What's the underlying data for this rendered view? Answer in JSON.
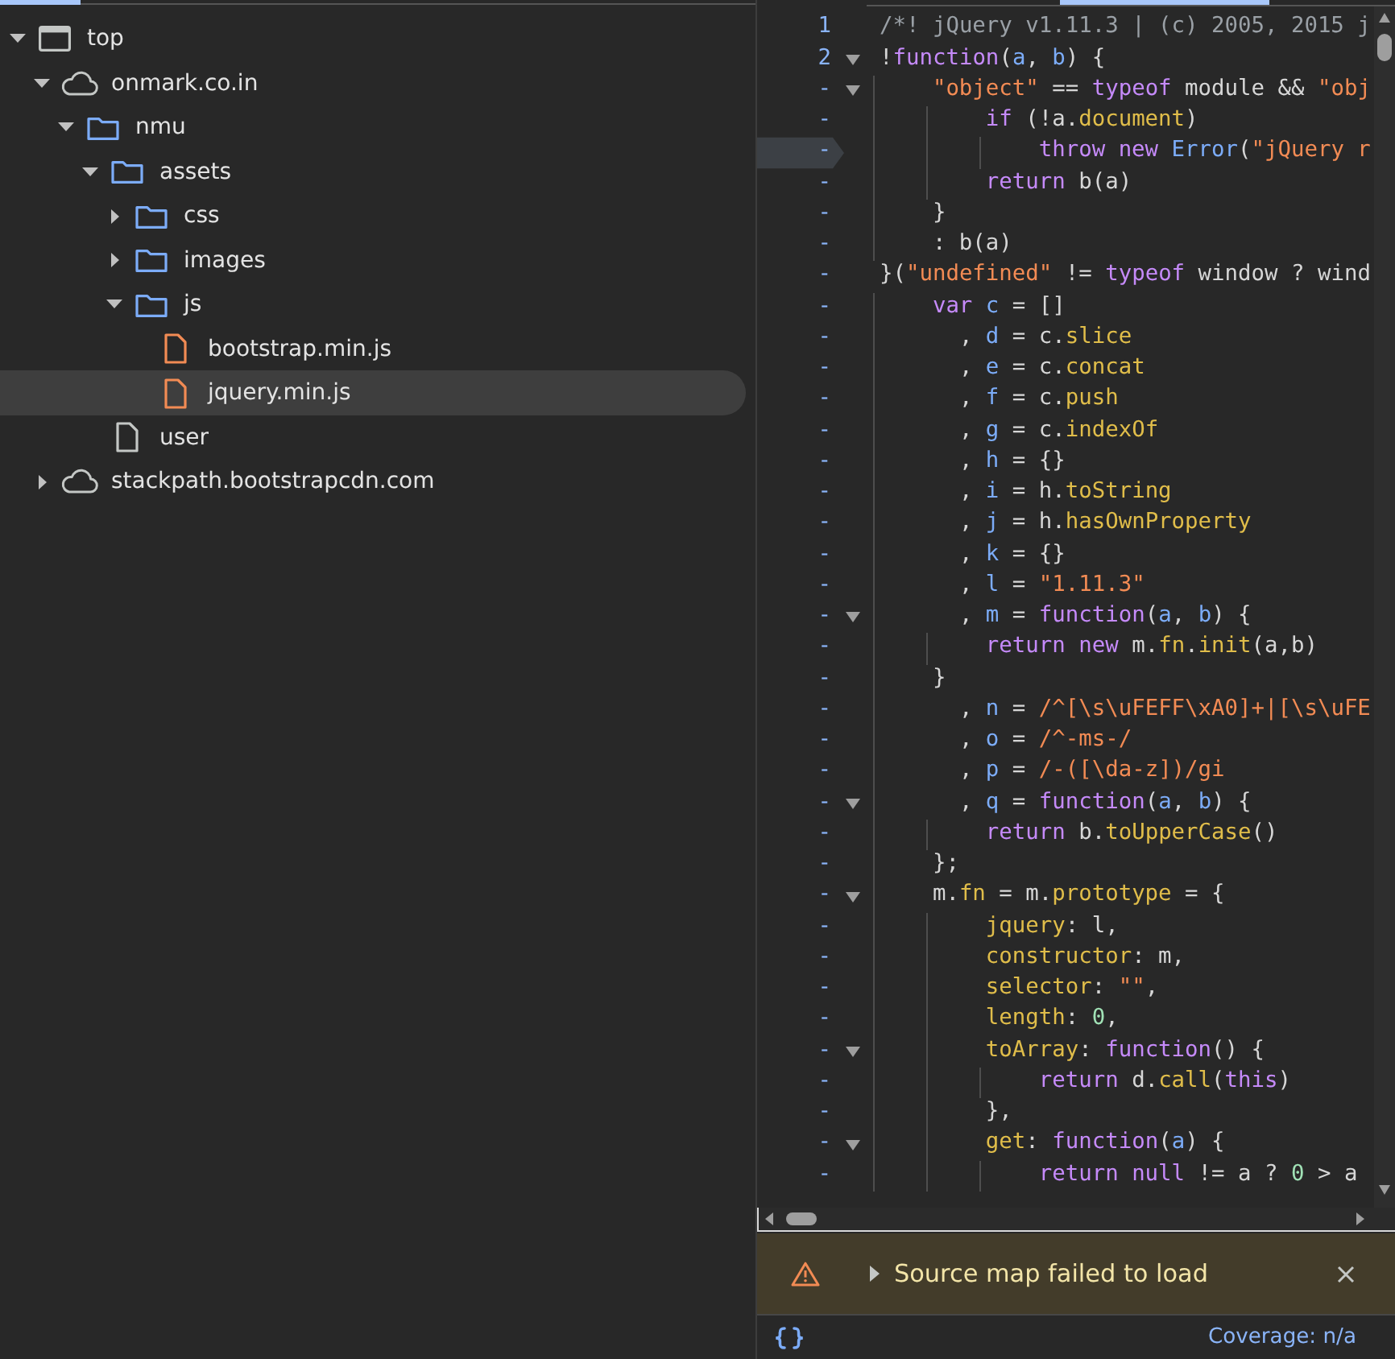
{
  "file_tree": [
    {
      "label": "top",
      "kind": "frame",
      "expanded": true,
      "selected": false,
      "children": [
        {
          "label": "onmark.co.in",
          "kind": "domain",
          "expanded": true,
          "selected": false,
          "children": [
            {
              "label": "nmu",
              "kind": "folder",
              "expanded": true,
              "selected": false,
              "children": [
                {
                  "label": "assets",
                  "kind": "folder",
                  "expanded": true,
                  "selected": false,
                  "children": [
                    {
                      "label": "css",
                      "kind": "folder",
                      "expanded": false,
                      "selected": false
                    },
                    {
                      "label": "images",
                      "kind": "folder",
                      "expanded": false,
                      "selected": false
                    },
                    {
                      "label": "js",
                      "kind": "folder",
                      "expanded": true,
                      "selected": false,
                      "children": [
                        {
                          "label": "bootstrap.min.js",
                          "kind": "script",
                          "selected": false
                        },
                        {
                          "label": "jquery.min.js",
                          "kind": "script",
                          "selected": true
                        }
                      ]
                    }
                  ]
                },
                {
                  "label": "user",
                  "kind": "document",
                  "selected": false
                }
              ]
            }
          ]
        },
        {
          "label": "stackpath.bootstrapcdn.com",
          "kind": "domain",
          "expanded": false,
          "selected": false
        }
      ]
    }
  ],
  "editor": {
    "lines": [
      {
        "number": "1",
        "foldable": false,
        "marked": false,
        "tokens": [
          {
            "kind": "comment",
            "text": "/*! jQuery v1.11.3 | (c) 2005, 2015 j"
          }
        ]
      },
      {
        "number": "2",
        "foldable": true,
        "marked": false,
        "tokens": [
          {
            "kind": "plain",
            "text": "!"
          },
          {
            "kind": "keyword",
            "text": "function"
          },
          {
            "kind": "plain",
            "text": "("
          },
          {
            "kind": "definition",
            "text": "a"
          },
          {
            "kind": "plain",
            "text": ", "
          },
          {
            "kind": "definition",
            "text": "b"
          },
          {
            "kind": "plain",
            "text": ") {"
          }
        ]
      },
      {
        "number": "-",
        "foldable": true,
        "marked": false,
        "tokens": [
          {
            "kind": "string",
            "text": "    \"object\""
          },
          {
            "kind": "plain",
            "text": " == "
          },
          {
            "kind": "keyword",
            "text": "typeof"
          },
          {
            "kind": "plain",
            "text": " module && "
          },
          {
            "kind": "string",
            "text": "\"obj"
          }
        ]
      },
      {
        "number": "-",
        "foldable": false,
        "marked": false,
        "tokens": [
          {
            "kind": "keyword",
            "text": "        if"
          },
          {
            "kind": "plain",
            "text": " (!a."
          },
          {
            "kind": "property",
            "text": "document"
          },
          {
            "kind": "plain",
            "text": ")"
          }
        ]
      },
      {
        "number": "-",
        "foldable": false,
        "marked": true,
        "tokens": [
          {
            "kind": "keyword",
            "text": "            throw"
          },
          {
            "kind": "keyword",
            "text": " new"
          },
          {
            "kind": "type",
            "text": " Error"
          },
          {
            "kind": "plain",
            "text": "("
          },
          {
            "kind": "string",
            "text": "\"jQuery r"
          }
        ]
      },
      {
        "number": "-",
        "foldable": false,
        "marked": false,
        "tokens": [
          {
            "kind": "keyword",
            "text": "        return"
          },
          {
            "kind": "plain",
            "text": " b(a)"
          }
        ]
      },
      {
        "number": "-",
        "foldable": false,
        "marked": false,
        "tokens": [
          {
            "kind": "plain",
            "text": "    }"
          }
        ]
      },
      {
        "number": "-",
        "foldable": false,
        "marked": false,
        "tokens": [
          {
            "kind": "plain",
            "text": "    : b(a)"
          }
        ]
      },
      {
        "number": "-",
        "foldable": false,
        "marked": false,
        "tokens": [
          {
            "kind": "plain",
            "text": "}("
          },
          {
            "kind": "string",
            "text": "\"undefined\""
          },
          {
            "kind": "plain",
            "text": " != "
          },
          {
            "kind": "keyword",
            "text": "typeof"
          },
          {
            "kind": "plain",
            "text": " window ? wind"
          }
        ]
      },
      {
        "number": "-",
        "foldable": false,
        "marked": false,
        "tokens": [
          {
            "kind": "keyword",
            "text": "    var"
          },
          {
            "kind": "definition",
            "text": " c"
          },
          {
            "kind": "plain",
            "text": " = []"
          }
        ]
      },
      {
        "number": "-",
        "foldable": false,
        "marked": false,
        "tokens": [
          {
            "kind": "plain",
            "text": "      , "
          },
          {
            "kind": "definition",
            "text": "d"
          },
          {
            "kind": "plain",
            "text": " = c."
          },
          {
            "kind": "property",
            "text": "slice"
          }
        ]
      },
      {
        "number": "-",
        "foldable": false,
        "marked": false,
        "tokens": [
          {
            "kind": "plain",
            "text": "      , "
          },
          {
            "kind": "definition",
            "text": "e"
          },
          {
            "kind": "plain",
            "text": " = c."
          },
          {
            "kind": "property",
            "text": "concat"
          }
        ]
      },
      {
        "number": "-",
        "foldable": false,
        "marked": false,
        "tokens": [
          {
            "kind": "plain",
            "text": "      , "
          },
          {
            "kind": "definition",
            "text": "f"
          },
          {
            "kind": "plain",
            "text": " = c."
          },
          {
            "kind": "property",
            "text": "push"
          }
        ]
      },
      {
        "number": "-",
        "foldable": false,
        "marked": false,
        "tokens": [
          {
            "kind": "plain",
            "text": "      , "
          },
          {
            "kind": "definition",
            "text": "g"
          },
          {
            "kind": "plain",
            "text": " = c."
          },
          {
            "kind": "property",
            "text": "indexOf"
          }
        ]
      },
      {
        "number": "-",
        "foldable": false,
        "marked": false,
        "tokens": [
          {
            "kind": "plain",
            "text": "      , "
          },
          {
            "kind": "definition",
            "text": "h"
          },
          {
            "kind": "plain",
            "text": " = {}"
          }
        ]
      },
      {
        "number": "-",
        "foldable": false,
        "marked": false,
        "tokens": [
          {
            "kind": "plain",
            "text": "      , "
          },
          {
            "kind": "definition",
            "text": "i"
          },
          {
            "kind": "plain",
            "text": " = h."
          },
          {
            "kind": "property",
            "text": "toString"
          }
        ]
      },
      {
        "number": "-",
        "foldable": false,
        "marked": false,
        "tokens": [
          {
            "kind": "plain",
            "text": "      , "
          },
          {
            "kind": "definition",
            "text": "j"
          },
          {
            "kind": "plain",
            "text": " = h."
          },
          {
            "kind": "property",
            "text": "hasOwnProperty"
          }
        ]
      },
      {
        "number": "-",
        "foldable": false,
        "marked": false,
        "tokens": [
          {
            "kind": "plain",
            "text": "      , "
          },
          {
            "kind": "definition",
            "text": "k"
          },
          {
            "kind": "plain",
            "text": " = {}"
          }
        ]
      },
      {
        "number": "-",
        "foldable": false,
        "marked": false,
        "tokens": [
          {
            "kind": "plain",
            "text": "      , "
          },
          {
            "kind": "definition",
            "text": "l"
          },
          {
            "kind": "plain",
            "text": " = "
          },
          {
            "kind": "string",
            "text": "\"1.11.3\""
          }
        ]
      },
      {
        "number": "-",
        "foldable": true,
        "marked": false,
        "tokens": [
          {
            "kind": "plain",
            "text": "      , "
          },
          {
            "kind": "definition",
            "text": "m"
          },
          {
            "kind": "plain",
            "text": " = "
          },
          {
            "kind": "keyword",
            "text": "function"
          },
          {
            "kind": "plain",
            "text": "("
          },
          {
            "kind": "definition",
            "text": "a"
          },
          {
            "kind": "plain",
            "text": ", "
          },
          {
            "kind": "definition",
            "text": "b"
          },
          {
            "kind": "plain",
            "text": ") {"
          }
        ]
      },
      {
        "number": "-",
        "foldable": false,
        "marked": false,
        "tokens": [
          {
            "kind": "keyword",
            "text": "        return"
          },
          {
            "kind": "keyword",
            "text": " new"
          },
          {
            "kind": "plain",
            "text": " m."
          },
          {
            "kind": "property",
            "text": "fn"
          },
          {
            "kind": "plain",
            "text": "."
          },
          {
            "kind": "property",
            "text": "init"
          },
          {
            "kind": "plain",
            "text": "(a,b)"
          }
        ]
      },
      {
        "number": "-",
        "foldable": false,
        "marked": false,
        "tokens": [
          {
            "kind": "plain",
            "text": "    }"
          }
        ]
      },
      {
        "number": "-",
        "foldable": false,
        "marked": false,
        "tokens": [
          {
            "kind": "plain",
            "text": "      , "
          },
          {
            "kind": "definition",
            "text": "n"
          },
          {
            "kind": "plain",
            "text": " = "
          },
          {
            "kind": "string",
            "text": "/^[\\s\\uFEFF\\xA0]+|[\\s\\uFE"
          }
        ]
      },
      {
        "number": "-",
        "foldable": false,
        "marked": false,
        "tokens": [
          {
            "kind": "plain",
            "text": "      , "
          },
          {
            "kind": "definition",
            "text": "o"
          },
          {
            "kind": "plain",
            "text": " = "
          },
          {
            "kind": "string",
            "text": "/^-ms-/"
          }
        ]
      },
      {
        "number": "-",
        "foldable": false,
        "marked": false,
        "tokens": [
          {
            "kind": "plain",
            "text": "      , "
          },
          {
            "kind": "definition",
            "text": "p"
          },
          {
            "kind": "plain",
            "text": " = "
          },
          {
            "kind": "string",
            "text": "/-([\\da-z])/gi"
          }
        ]
      },
      {
        "number": "-",
        "foldable": true,
        "marked": false,
        "tokens": [
          {
            "kind": "plain",
            "text": "      , "
          },
          {
            "kind": "definition",
            "text": "q"
          },
          {
            "kind": "plain",
            "text": " = "
          },
          {
            "kind": "keyword",
            "text": "function"
          },
          {
            "kind": "plain",
            "text": "("
          },
          {
            "kind": "definition",
            "text": "a"
          },
          {
            "kind": "plain",
            "text": ", "
          },
          {
            "kind": "definition",
            "text": "b"
          },
          {
            "kind": "plain",
            "text": ") {"
          }
        ]
      },
      {
        "number": "-",
        "foldable": false,
        "marked": false,
        "tokens": [
          {
            "kind": "keyword",
            "text": "        return"
          },
          {
            "kind": "plain",
            "text": " b."
          },
          {
            "kind": "property",
            "text": "toUpperCase"
          },
          {
            "kind": "plain",
            "text": "()"
          }
        ]
      },
      {
        "number": "-",
        "foldable": false,
        "marked": false,
        "tokens": [
          {
            "kind": "plain",
            "text": "    };"
          }
        ]
      },
      {
        "number": "-",
        "foldable": true,
        "marked": false,
        "tokens": [
          {
            "kind": "plain",
            "text": "    m."
          },
          {
            "kind": "property",
            "text": "fn"
          },
          {
            "kind": "plain",
            "text": " = m."
          },
          {
            "kind": "property",
            "text": "prototype"
          },
          {
            "kind": "plain",
            "text": " = {"
          }
        ]
      },
      {
        "number": "-",
        "foldable": false,
        "marked": false,
        "tokens": [
          {
            "kind": "property",
            "text": "        jquery"
          },
          {
            "kind": "plain",
            "text": ": l,"
          }
        ]
      },
      {
        "number": "-",
        "foldable": false,
        "marked": false,
        "tokens": [
          {
            "kind": "property",
            "text": "        constructor"
          },
          {
            "kind": "plain",
            "text": ": m,"
          }
        ]
      },
      {
        "number": "-",
        "foldable": false,
        "marked": false,
        "tokens": [
          {
            "kind": "property",
            "text": "        selector"
          },
          {
            "kind": "plain",
            "text": ": "
          },
          {
            "kind": "string",
            "text": "\"\""
          },
          {
            "kind": "plain",
            "text": ","
          }
        ]
      },
      {
        "number": "-",
        "foldable": false,
        "marked": false,
        "tokens": [
          {
            "kind": "property",
            "text": "        length"
          },
          {
            "kind": "plain",
            "text": ": "
          },
          {
            "kind": "number",
            "text": "0"
          },
          {
            "kind": "plain",
            "text": ","
          }
        ]
      },
      {
        "number": "-",
        "foldable": true,
        "marked": false,
        "tokens": [
          {
            "kind": "property",
            "text": "        toArray"
          },
          {
            "kind": "plain",
            "text": ": "
          },
          {
            "kind": "keyword",
            "text": "function"
          },
          {
            "kind": "plain",
            "text": "() {"
          }
        ]
      },
      {
        "number": "-",
        "foldable": false,
        "marked": false,
        "tokens": [
          {
            "kind": "keyword",
            "text": "            return"
          },
          {
            "kind": "plain",
            "text": " d."
          },
          {
            "kind": "property",
            "text": "call"
          },
          {
            "kind": "plain",
            "text": "("
          },
          {
            "kind": "keyword",
            "text": "this"
          },
          {
            "kind": "plain",
            "text": ")"
          }
        ]
      },
      {
        "number": "-",
        "foldable": false,
        "marked": false,
        "tokens": [
          {
            "kind": "plain",
            "text": "        },"
          }
        ]
      },
      {
        "number": "-",
        "foldable": true,
        "marked": false,
        "tokens": [
          {
            "kind": "property",
            "text": "        get"
          },
          {
            "kind": "plain",
            "text": ": "
          },
          {
            "kind": "keyword",
            "text": "function"
          },
          {
            "kind": "plain",
            "text": "("
          },
          {
            "kind": "definition",
            "text": "a"
          },
          {
            "kind": "plain",
            "text": ") {"
          }
        ]
      },
      {
        "number": "-",
        "foldable": false,
        "marked": false,
        "tokens": [
          {
            "kind": "keyword",
            "text": "            return"
          },
          {
            "kind": "keyword",
            "text": " null"
          },
          {
            "kind": "plain",
            "text": " != a ? "
          },
          {
            "kind": "number",
            "text": "0"
          },
          {
            "kind": "plain",
            "text": " > a"
          }
        ]
      }
    ]
  },
  "message_bar": {
    "text": "Source map failed to load",
    "expanded": false
  },
  "status_bar": {
    "coverage": "Coverage: n/a"
  }
}
